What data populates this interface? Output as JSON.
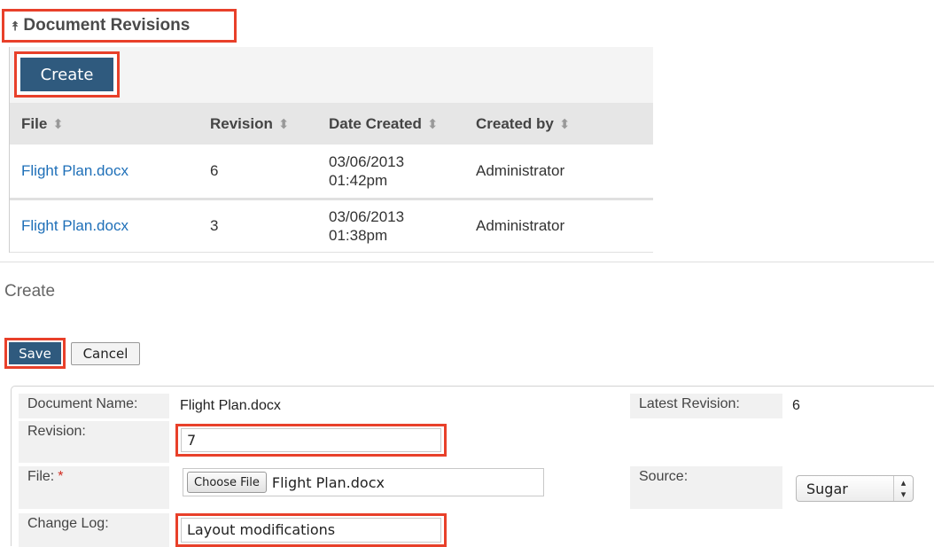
{
  "subpanel": {
    "title": "Document Revisions",
    "create_label": "Create",
    "columns": [
      "File",
      "Revision",
      "Date Created",
      "Created by"
    ],
    "rows": [
      {
        "file": "Flight Plan.docx",
        "revision": "6",
        "date": "03/06/2013",
        "time": "01:42pm",
        "created_by": "Administrator"
      },
      {
        "file": "Flight Plan.docx",
        "revision": "3",
        "date": "03/06/2013",
        "time": "01:38pm",
        "created_by": "Administrator"
      }
    ]
  },
  "form": {
    "title": "Create",
    "save_label": "Save",
    "cancel_label": "Cancel",
    "document_name_label": "Document Name:",
    "document_name_value": "Flight Plan.docx",
    "latest_revision_label": "Latest Revision:",
    "latest_revision_value": "6",
    "revision_label": "Revision:",
    "revision_value": "7",
    "file_label": "File:",
    "file_required_mark": "*",
    "choose_file_label": "Choose File",
    "file_value": "Flight Plan.docx",
    "source_label": "Source:",
    "source_value": "Sugar",
    "change_log_label": "Change Log:",
    "change_log_value": "Layout modifications"
  },
  "colors": {
    "highlight": "#e8402a",
    "button_primary": "#2f5a7e",
    "link": "#1e6fb8",
    "required": "#d0291e"
  },
  "icons": {
    "collapse": "double-chevron-up-icon",
    "sort": "sort-arrows-icon",
    "select": "select-arrows-icon"
  }
}
